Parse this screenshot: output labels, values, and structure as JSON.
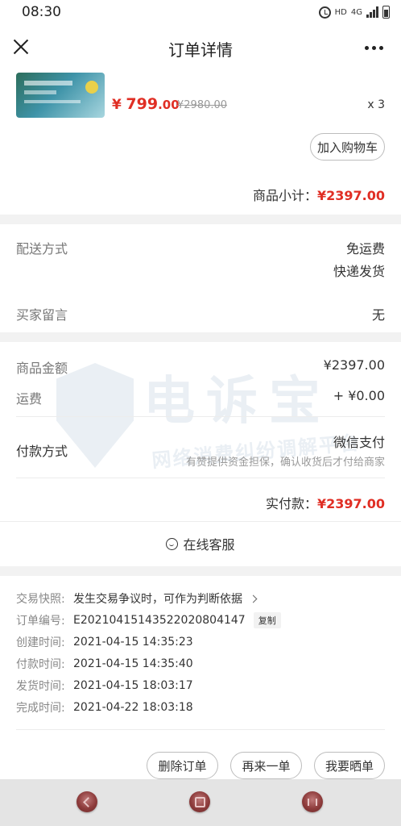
{
  "status_bar": {
    "time": "08:30",
    "hd": "HD",
    "network": "4G"
  },
  "nav": {
    "title": "订单详情"
  },
  "product": {
    "price_symbol": "¥",
    "price_int": "799",
    "price_dec": ".00",
    "original_price": "¥2980.00",
    "quantity": "x 3",
    "add_to_cart": "加入购物车",
    "subtotal_label": "商品小计：",
    "subtotal_value": "¥2397.00"
  },
  "delivery": {
    "method_label": "配送方式",
    "method_value_1": "免运费",
    "method_value_2": "快递发货",
    "message_label": "买家留言",
    "message_value": "无"
  },
  "payment": {
    "goods_amount_label": "商品金额",
    "goods_amount_value": "¥2397.00",
    "shipping_label": "运费",
    "shipping_value": "+ ¥0.00",
    "method_label": "付款方式",
    "method_value": "微信支付",
    "method_note": "有赞提供资金担保，确认收货后才付给商家",
    "paid_label": "实付款：",
    "paid_value": "¥2397.00",
    "service": "在线客服"
  },
  "watermark": {
    "big": "电诉宝",
    "small": "网络消费纠纷调解平台"
  },
  "order_info": {
    "snapshot_label": "交易快照:",
    "snapshot_value": "发生交易争议时，可作为判断依据",
    "order_no_label": "订单编号:",
    "order_no_value": "E20210415143522020804147",
    "copy": "复制",
    "created_label": "创建时间:",
    "created_value": "2021-04-15 14:35:23",
    "paid_label": "付款时间:",
    "paid_value": "2021-04-15 14:35:40",
    "shipped_label": "发货时间:",
    "shipped_value": "2021-04-15 18:03:17",
    "completed_label": "完成时间:",
    "completed_value": "2021-04-22 18:03:18"
  },
  "actions": {
    "delete": "删除订单",
    "buy_again": "再来一单",
    "share": "我要晒单"
  },
  "colors": {
    "accent_red": "#e02e24",
    "background": "#f2f2f2"
  }
}
